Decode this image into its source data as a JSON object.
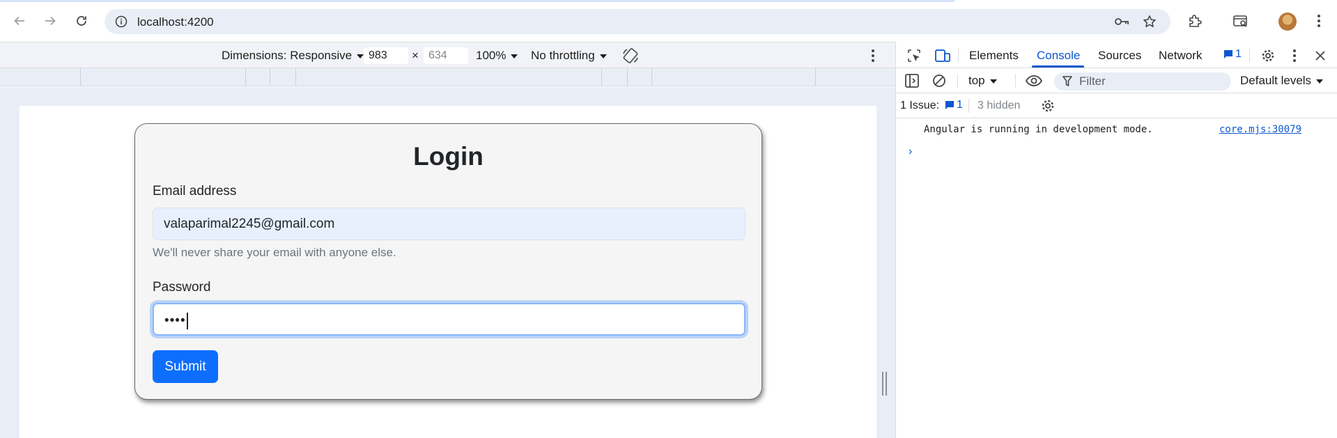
{
  "browser": {
    "url": "localhost:4200",
    "icons": [
      "back-icon",
      "forward-icon",
      "reload-icon",
      "site-info-icon",
      "password-key-icon",
      "bookmark-star-icon",
      "extensions-icon",
      "tab-search-icon",
      "profile-avatar",
      "menu-icon"
    ]
  },
  "device_toolbar": {
    "dimensions_label": "Dimensions: Responsive",
    "width": "983",
    "x_sep": "×",
    "height": "634",
    "zoom": "100%",
    "throttling": "No throttling"
  },
  "login": {
    "title": "Login",
    "email_label": "Email address",
    "email_value": "valaparimal2245@gmail.com",
    "email_help": "We'll never share your email with anyone else.",
    "password_label": "Password",
    "password_value": "••••",
    "submit_label": "Submit"
  },
  "devtools": {
    "tabs": [
      "Elements",
      "Console",
      "Sources",
      "Network"
    ],
    "active_tab": "Console",
    "issue_count": "1",
    "context": "top",
    "filter_placeholder": "Filter",
    "levels": "Default levels",
    "issues_label": "1 Issue:",
    "issues_count": "1",
    "hidden_label": "3 hidden",
    "console_message": "Angular is running in development mode.",
    "console_source": "core.mjs:30079",
    "prompt": "›"
  },
  "colors": {
    "accent": "#0b57d0",
    "button": "#0d6efd",
    "omnibox": "#e9eef6"
  }
}
